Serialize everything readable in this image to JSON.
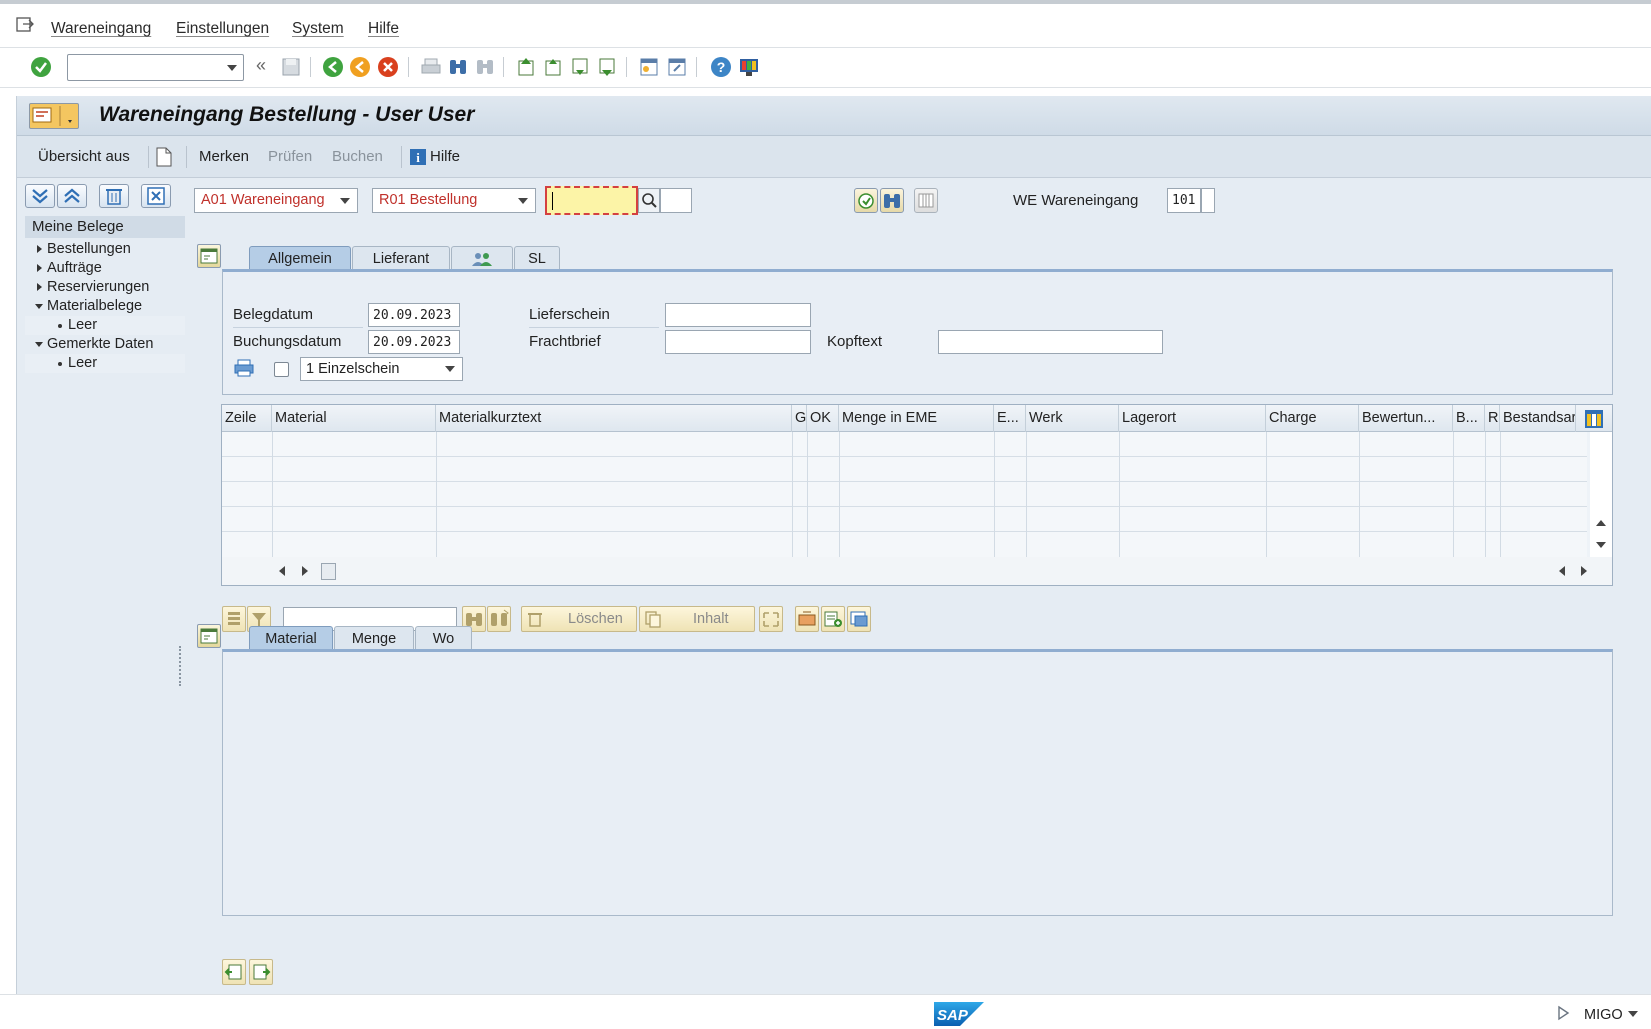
{
  "menu": {
    "items": [
      "Wareneingang",
      "Einstellungen",
      "System",
      "Hilfe"
    ]
  },
  "app": {
    "title": "Wareneingang Bestellung - User User",
    "toolbar": {
      "overview_off": "Übersicht aus",
      "bookmark": "Merken",
      "check": "Prüfen",
      "post": "Buchen",
      "help": "Hilfe"
    }
  },
  "left_panel": {
    "header": "Meine Belege",
    "items": [
      {
        "label": "Bestellungen"
      },
      {
        "label": "Aufträge"
      },
      {
        "label": "Reservierungen"
      },
      {
        "label": "Materialbelege"
      },
      {
        "label": "Leer"
      },
      {
        "label": "Gemerkte Daten"
      },
      {
        "label": "Leer"
      }
    ]
  },
  "selection": {
    "action": "A01 Wareneingang",
    "reference": "R01 Bestellung",
    "document_number": "",
    "movement_label": "WE Wareneingang",
    "movement_type": "101"
  },
  "header_tabs": [
    "Allgemein",
    "Lieferant",
    "SL"
  ],
  "header_fields": {
    "document_date_label": "Belegdatum",
    "document_date": "20.09.2023",
    "posting_date_label": "Buchungsdatum",
    "posting_date": "20.09.2023",
    "delivery_note_label": "Lieferschein",
    "bill_of_lading_label": "Frachtbrief",
    "header_text_label": "Kopftext",
    "slip_option": "1 Einzelschein"
  },
  "table": {
    "columns": [
      "Zeile",
      "Material",
      "Materialkurztext",
      "G",
      "OK",
      "Menge in EME",
      "E...",
      "Werk",
      "Lagerort",
      "Charge",
      "Bewertun...",
      "B...",
      "R",
      "Bestandsar"
    ]
  },
  "table_toolbar": {
    "delete": "Löschen",
    "content": "Inhalt"
  },
  "detail_tabs": [
    "Material",
    "Menge",
    "Wo"
  ],
  "status": {
    "transaction": "MIGO"
  },
  "colors": {
    "accent_red": "#c0312b",
    "frame_bg": "#e5ecf3"
  }
}
